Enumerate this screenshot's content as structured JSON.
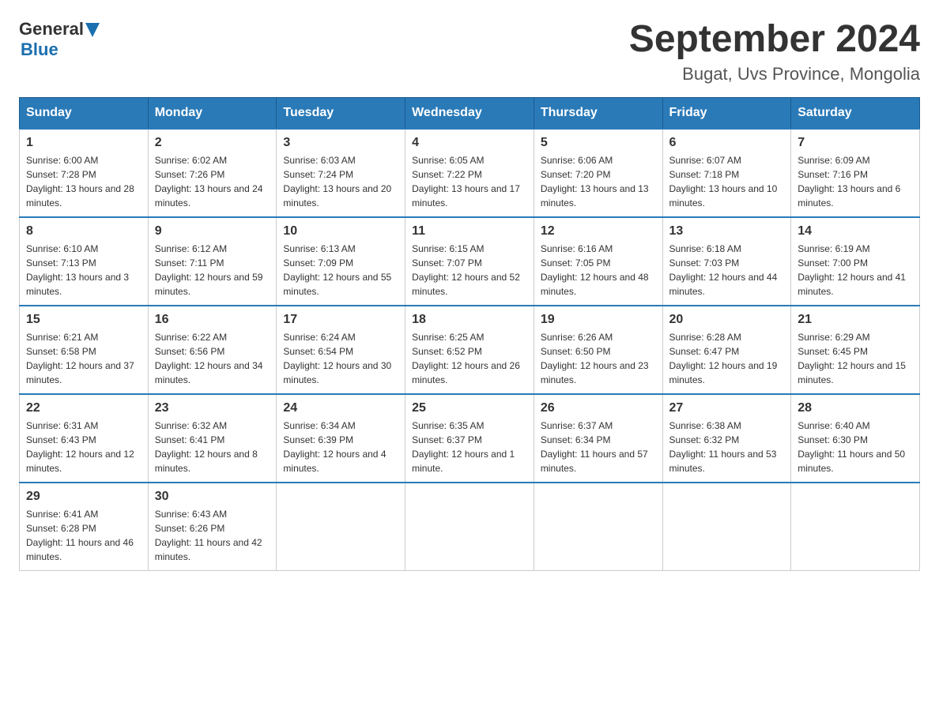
{
  "header": {
    "logo": {
      "text_general": "General",
      "text_blue": "Blue",
      "aria": "GeneralBlue logo"
    },
    "title": "September 2024",
    "location": "Bugat, Uvs Province, Mongolia"
  },
  "calendar": {
    "days_of_week": [
      "Sunday",
      "Monday",
      "Tuesday",
      "Wednesday",
      "Thursday",
      "Friday",
      "Saturday"
    ],
    "weeks": [
      [
        {
          "day": 1,
          "sunrise": "6:00 AM",
          "sunset": "7:28 PM",
          "daylight": "13 hours and 28 minutes."
        },
        {
          "day": 2,
          "sunrise": "6:02 AM",
          "sunset": "7:26 PM",
          "daylight": "13 hours and 24 minutes."
        },
        {
          "day": 3,
          "sunrise": "6:03 AM",
          "sunset": "7:24 PM",
          "daylight": "13 hours and 20 minutes."
        },
        {
          "day": 4,
          "sunrise": "6:05 AM",
          "sunset": "7:22 PM",
          "daylight": "13 hours and 17 minutes."
        },
        {
          "day": 5,
          "sunrise": "6:06 AM",
          "sunset": "7:20 PM",
          "daylight": "13 hours and 13 minutes."
        },
        {
          "day": 6,
          "sunrise": "6:07 AM",
          "sunset": "7:18 PM",
          "daylight": "13 hours and 10 minutes."
        },
        {
          "day": 7,
          "sunrise": "6:09 AM",
          "sunset": "7:16 PM",
          "daylight": "13 hours and 6 minutes."
        }
      ],
      [
        {
          "day": 8,
          "sunrise": "6:10 AM",
          "sunset": "7:13 PM",
          "daylight": "13 hours and 3 minutes."
        },
        {
          "day": 9,
          "sunrise": "6:12 AM",
          "sunset": "7:11 PM",
          "daylight": "12 hours and 59 minutes."
        },
        {
          "day": 10,
          "sunrise": "6:13 AM",
          "sunset": "7:09 PM",
          "daylight": "12 hours and 55 minutes."
        },
        {
          "day": 11,
          "sunrise": "6:15 AM",
          "sunset": "7:07 PM",
          "daylight": "12 hours and 52 minutes."
        },
        {
          "day": 12,
          "sunrise": "6:16 AM",
          "sunset": "7:05 PM",
          "daylight": "12 hours and 48 minutes."
        },
        {
          "day": 13,
          "sunrise": "6:18 AM",
          "sunset": "7:03 PM",
          "daylight": "12 hours and 44 minutes."
        },
        {
          "day": 14,
          "sunrise": "6:19 AM",
          "sunset": "7:00 PM",
          "daylight": "12 hours and 41 minutes."
        }
      ],
      [
        {
          "day": 15,
          "sunrise": "6:21 AM",
          "sunset": "6:58 PM",
          "daylight": "12 hours and 37 minutes."
        },
        {
          "day": 16,
          "sunrise": "6:22 AM",
          "sunset": "6:56 PM",
          "daylight": "12 hours and 34 minutes."
        },
        {
          "day": 17,
          "sunrise": "6:24 AM",
          "sunset": "6:54 PM",
          "daylight": "12 hours and 30 minutes."
        },
        {
          "day": 18,
          "sunrise": "6:25 AM",
          "sunset": "6:52 PM",
          "daylight": "12 hours and 26 minutes."
        },
        {
          "day": 19,
          "sunrise": "6:26 AM",
          "sunset": "6:50 PM",
          "daylight": "12 hours and 23 minutes."
        },
        {
          "day": 20,
          "sunrise": "6:28 AM",
          "sunset": "6:47 PM",
          "daylight": "12 hours and 19 minutes."
        },
        {
          "day": 21,
          "sunrise": "6:29 AM",
          "sunset": "6:45 PM",
          "daylight": "12 hours and 15 minutes."
        }
      ],
      [
        {
          "day": 22,
          "sunrise": "6:31 AM",
          "sunset": "6:43 PM",
          "daylight": "12 hours and 12 minutes."
        },
        {
          "day": 23,
          "sunrise": "6:32 AM",
          "sunset": "6:41 PM",
          "daylight": "12 hours and 8 minutes."
        },
        {
          "day": 24,
          "sunrise": "6:34 AM",
          "sunset": "6:39 PM",
          "daylight": "12 hours and 4 minutes."
        },
        {
          "day": 25,
          "sunrise": "6:35 AM",
          "sunset": "6:37 PM",
          "daylight": "12 hours and 1 minute."
        },
        {
          "day": 26,
          "sunrise": "6:37 AM",
          "sunset": "6:34 PM",
          "daylight": "11 hours and 57 minutes."
        },
        {
          "day": 27,
          "sunrise": "6:38 AM",
          "sunset": "6:32 PM",
          "daylight": "11 hours and 53 minutes."
        },
        {
          "day": 28,
          "sunrise": "6:40 AM",
          "sunset": "6:30 PM",
          "daylight": "11 hours and 50 minutes."
        }
      ],
      [
        {
          "day": 29,
          "sunrise": "6:41 AM",
          "sunset": "6:28 PM",
          "daylight": "11 hours and 46 minutes."
        },
        {
          "day": 30,
          "sunrise": "6:43 AM",
          "sunset": "6:26 PM",
          "daylight": "11 hours and 42 minutes."
        },
        null,
        null,
        null,
        null,
        null
      ]
    ],
    "labels": {
      "sunrise": "Sunrise:",
      "sunset": "Sunset:",
      "daylight": "Daylight:"
    }
  }
}
